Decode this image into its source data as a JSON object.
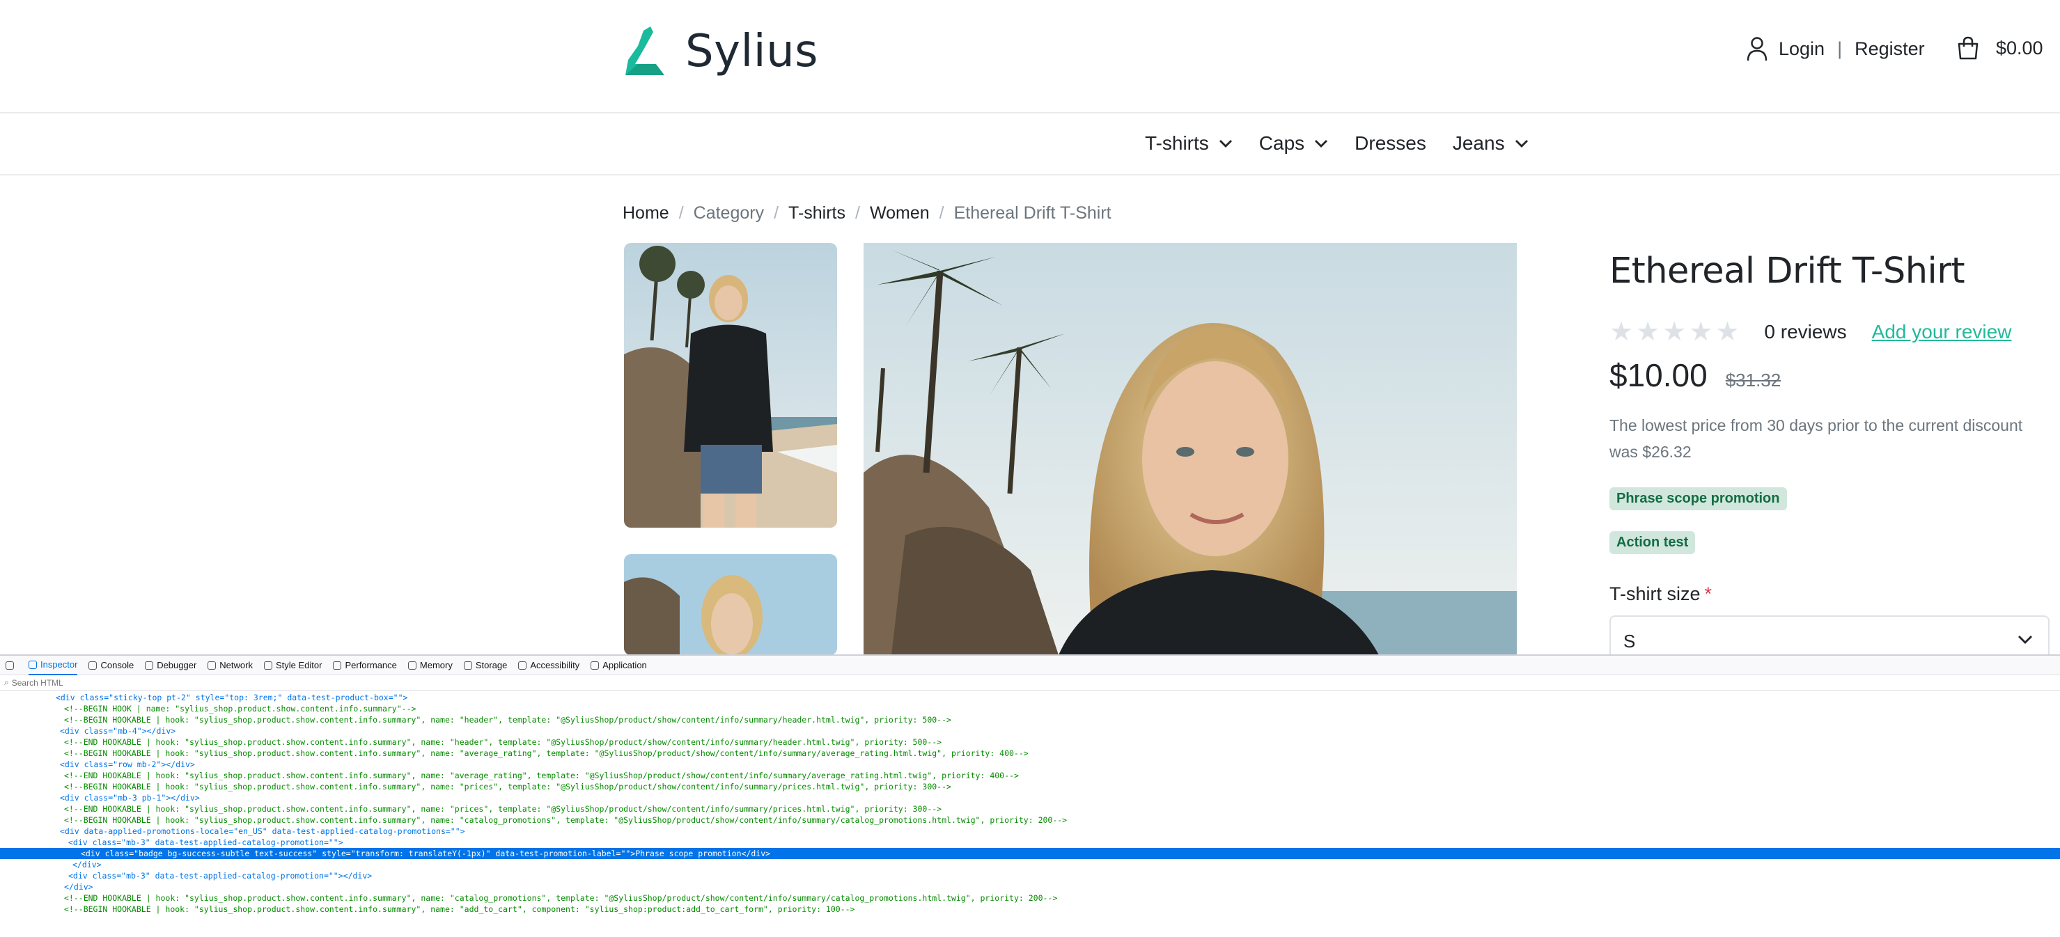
{
  "header": {
    "logo_text": "Sylius",
    "login": "Login",
    "separator": "|",
    "register": "Register",
    "cart_total": "$0.00"
  },
  "nav": {
    "items": [
      {
        "label": "T-shirts",
        "has_dropdown": true
      },
      {
        "label": "Caps",
        "has_dropdown": true
      },
      {
        "label": "Dresses",
        "has_dropdown": false
      },
      {
        "label": "Jeans",
        "has_dropdown": true
      }
    ]
  },
  "breadcrumb": [
    "Home",
    "Category",
    "T-shirts",
    "Women",
    "Ethereal Drift T-Shirt"
  ],
  "product": {
    "title": "Ethereal Drift T-Shirt",
    "reviews": "0 reviews",
    "add_review": "Add your review",
    "rating": 0,
    "rating_max": 5,
    "price": "$10.00",
    "original_price": "$31.32",
    "lowest_price_note": "The lowest price from 30 days prior to the current discount was $26.32",
    "promotions": [
      "Phrase scope promotion",
      "Action test"
    ],
    "size_label": "T-shirt size",
    "size_required_mark": "*",
    "size_value": "S"
  },
  "colors": {
    "accent": "#22b99a",
    "badge_bg": "#d1e7dd",
    "badge_text": "#146c43",
    "devtools_selection": "#0074e8"
  },
  "devtools": {
    "tabs": [
      "Inspector",
      "Console",
      "Debugger",
      "Network",
      "Style Editor",
      "Performance",
      "Memory",
      "Storage",
      "Accessibility",
      "Application"
    ],
    "active_tab": "Inspector",
    "search_placeholder": "Search HTML",
    "lines": [
      "<div class=\"sticky-top pt-2\" style=\"top: 3rem;\" data-test-product-box=\"\">",
      "<!--BEGIN HOOK | name: \"sylius_shop.product.show.content.info.summary\"-->",
      "<!--BEGIN HOOKABLE | hook: \"sylius_shop.product.show.content.info.summary\", name: \"header\", template: \"@SyliusShop/product/show/content/info/summary/header.html.twig\", priority: 500-->",
      "<div class=\"mb-4\"></div>",
      "<!--END HOOKABLE | hook: \"sylius_shop.product.show.content.info.summary\", name: \"header\", template: \"@SyliusShop/product/show/content/info/summary/header.html.twig\", priority: 500-->",
      "<!--BEGIN HOOKABLE | hook: \"sylius_shop.product.show.content.info.summary\", name: \"average_rating\", template: \"@SyliusShop/product/show/content/info/summary/average_rating.html.twig\", priority: 400-->",
      "<div class=\"row mb-2\"></div>",
      "<!--END HOOKABLE | hook: \"sylius_shop.product.show.content.info.summary\", name: \"average_rating\", template: \"@SyliusShop/product/show/content/info/summary/average_rating.html.twig\", priority: 400-->",
      "<!--BEGIN HOOKABLE | hook: \"sylius_shop.product.show.content.info.summary\", name: \"prices\", template: \"@SyliusShop/product/show/content/info/summary/prices.html.twig\", priority: 300-->",
      "<div class=\"mb-3 pb-1\"></div>",
      "<!--END HOOKABLE | hook: \"sylius_shop.product.show.content.info.summary\", name: \"prices\", template: \"@SyliusShop/product/show/content/info/summary/prices.html.twig\", priority: 300-->",
      "<!--BEGIN HOOKABLE | hook: \"sylius_shop.product.show.content.info.summary\", name: \"catalog_promotions\", template: \"@SyliusShop/product/show/content/info/summary/catalog_promotions.html.twig\", priority: 200-->",
      "<div data-applied-promotions-locale=\"en_US\" data-test-applied-catalog-promotions=\"\">",
      "<div class=\"mb-3\" data-test-applied-catalog-promotion=\"\">",
      "<div class=\"badge bg-success-subtle text-success\" style=\"transform: translateY(-1px)\" data-test-promotion-label=\"\">Phrase scope promotion</div>",
      "</div>",
      "<div class=\"mb-3\" data-test-applied-catalog-promotion=\"\"></div>",
      "</div>",
      "<!--END HOOKABLE | hook: \"sylius_shop.product.show.content.info.summary\", name: \"catalog_promotions\", template: \"@SyliusShop/product/show/content/info/summary/catalog_promotions.html.twig\", priority: 200-->",
      "<!--BEGIN HOOKABLE | hook: \"sylius_shop.product.show.content.info.summary\", name: \"add_to_cart\", component: \"sylius_shop:product:add_to_cart_form\", priority: 100-->"
    ]
  }
}
